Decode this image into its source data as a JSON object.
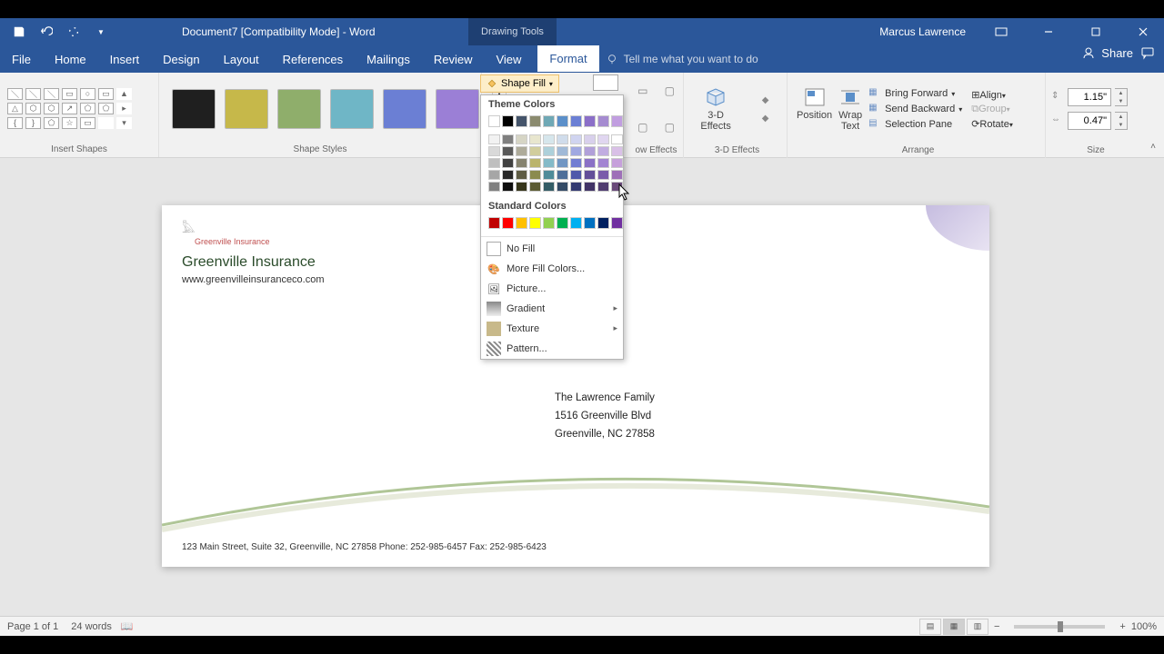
{
  "title": "Document7 [Compatibility Mode] - Word",
  "context_tab_label": "Drawing Tools",
  "user": "Marcus Lawrence",
  "tabs": {
    "file": "File",
    "home": "Home",
    "insert": "Insert",
    "design": "Design",
    "layout": "Layout",
    "references": "References",
    "mailings": "Mailings",
    "review": "Review",
    "view": "View",
    "format": "Format"
  },
  "tell_me_placeholder": "Tell me what you want to do",
  "share_label": "Share",
  "ribbon": {
    "insert_shapes": "Insert Shapes",
    "shape_styles": "Shape Styles",
    "shadow_effects": "ow Effects",
    "three_d_effects": "3-D Effects",
    "arrange": "Arrange",
    "size": "Size",
    "shape_fill_label": "Shape Fill",
    "three_d_effects_btn": "3-D\nEffects",
    "position": "Position",
    "wrap_text": "Wrap\nText",
    "bring_forward": "Bring Forward",
    "send_backward": "Send Backward",
    "selection_pane": "Selection Pane",
    "align": "Align",
    "group": "Group",
    "rotate": "Rotate",
    "height": "1.15\"",
    "width": "0.47\""
  },
  "style_colors": [
    "#1f1f1f",
    "#c6b84a",
    "#8fae6b",
    "#6fb6c6",
    "#6b7fd4",
    "#9b7fd6"
  ],
  "dropdown": {
    "theme_colors_label": "Theme Colors",
    "standard_colors_label": "Standard Colors",
    "theme_row1": [
      "#ffffff",
      "#000000",
      "#44546a",
      "#8b8b6f",
      "#6fa8b5",
      "#5b8fc9",
      "#6b7fd4",
      "#8b6fc8",
      "#a58bd0",
      "#c19ee0"
    ],
    "theme_col1": [
      "#f2f2f2",
      "#d9d9d9",
      "#bfbfbf",
      "#a6a6a6",
      "#808080"
    ],
    "theme_col2": [
      "#7f7f7f",
      "#595959",
      "#404040",
      "#262626",
      "#0d0d0d"
    ],
    "theme_col3": [
      "#d6d5c5",
      "#aeab9a",
      "#86836f",
      "#5e5c44",
      "#36351a"
    ],
    "theme_col4": [
      "#e8e6ce",
      "#d1cd9d",
      "#bab46c",
      "#8b8b4f",
      "#5c5c33"
    ],
    "theme_col5": [
      "#d6e6ec",
      "#add0da",
      "#84bac8",
      "#4f8b99",
      "#335c66"
    ],
    "theme_col6": [
      "#d0dceb",
      "#a0b9d7",
      "#7196c3",
      "#4f6f99",
      "#334a66"
    ],
    "theme_col7": [
      "#d0d4f0",
      "#a0a8e1",
      "#717dd2",
      "#4f59aa",
      "#333a71"
    ],
    "theme_col8": [
      "#d8d0ec",
      "#b1a0d9",
      "#8a71c6",
      "#624f99",
      "#413366"
    ],
    "theme_col9": [
      "#e0d6f0",
      "#c1ade1",
      "#a284d2",
      "#7a5caa",
      "#513d71"
    ],
    "theme_col10": [
      "#ecdf f3",
      "#d9c0e7",
      "#c6a0db",
      "#9e70b8",
      "#6a4a7a"
    ],
    "standard_row": [
      "#c00000",
      "#ff0000",
      "#ffc000",
      "#ffff00",
      "#92d050",
      "#00b050",
      "#00b0f0",
      "#0070c0",
      "#002060",
      "#7030a0"
    ],
    "no_fill": "No Fill",
    "more_colors": "More Fill Colors...",
    "picture": "Picture...",
    "gradient": "Gradient",
    "texture": "Texture",
    "pattern": "Pattern..."
  },
  "document": {
    "logo_text": "Greenville Insurance",
    "company_name": "Greenville Insurance",
    "company_url": "www.greenvilleinsuranceco.com",
    "recipient_line1": "The Lawrence Family",
    "recipient_line2": "1516 Greenville Blvd",
    "recipient_line3": "Greenville, NC 27858",
    "footer": "123 Main Street, Suite 32, Greenville, NC 27858 Phone: 252-985-6457 Fax: 252-985-6423"
  },
  "status": {
    "page": "Page 1 of 1",
    "words": "24 words",
    "zoom": "100%"
  }
}
